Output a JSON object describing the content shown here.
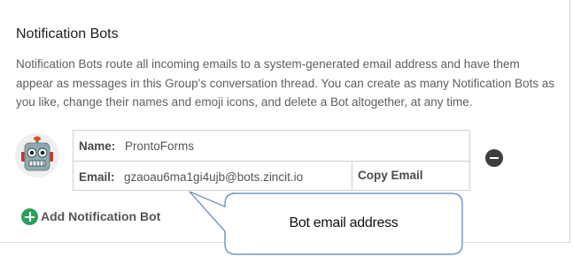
{
  "section": {
    "title": "Notification Bots",
    "description": "Notification Bots route all incoming emails to a system-generated email address and have them appear as messages in this Group's conversation thread. You can create as many Notification Bots as you like, change their names and emoji icons, and delete a Bot altogether, at any time."
  },
  "bot": {
    "icon": "robot-emoji-icon",
    "name_label": "Name:",
    "name_value": "ProntoForms",
    "email_label": "Email:",
    "email_value": "gzaoau6ma1gi4ujb@bots.zincit.io",
    "copy_label": "Copy Email",
    "remove_icon": "minus-circle-icon"
  },
  "add_bot": {
    "icon": "plus-circle-icon",
    "label": "Add Notification Bot"
  },
  "callout": {
    "text": "Bot email address"
  },
  "colors": {
    "add_green": "#2e9e5e",
    "callout_border": "#5b7fb8",
    "remove_dark": "#3e3e3e"
  }
}
